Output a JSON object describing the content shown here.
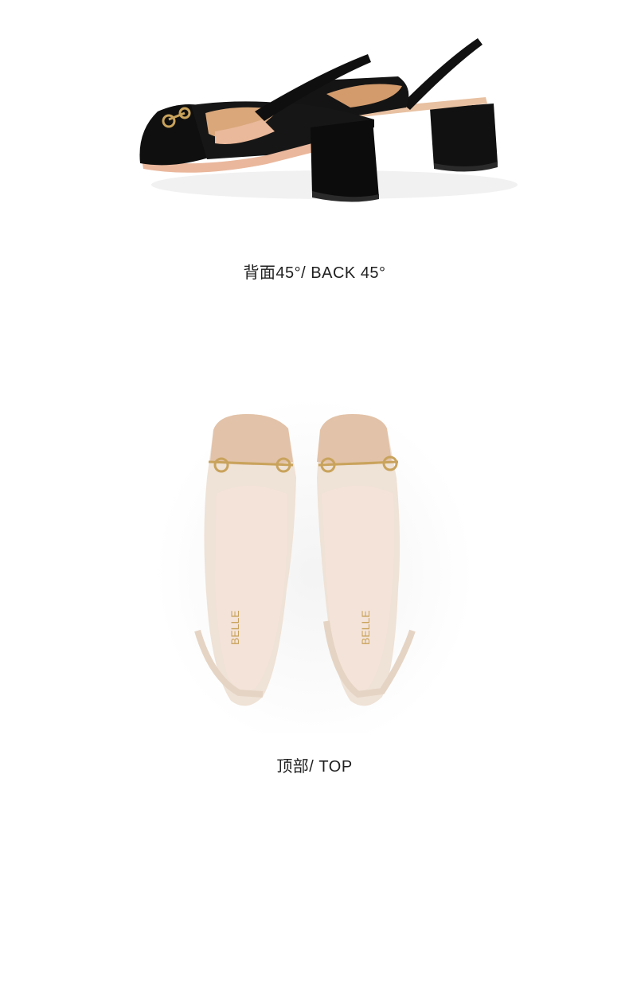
{
  "sections": {
    "back": {
      "caption": "背面45°/ BACK 45°",
      "shoe_color": "#111111",
      "lining_color": "#d9a77a"
    },
    "top": {
      "caption": "顶部/ TOP",
      "toe_color": "#e2c2a8",
      "upper_color": "#efe2d6",
      "insole_color": "#f4e3d9",
      "hardware_color": "#c9a35c",
      "insole_brand": "BELLE"
    }
  }
}
